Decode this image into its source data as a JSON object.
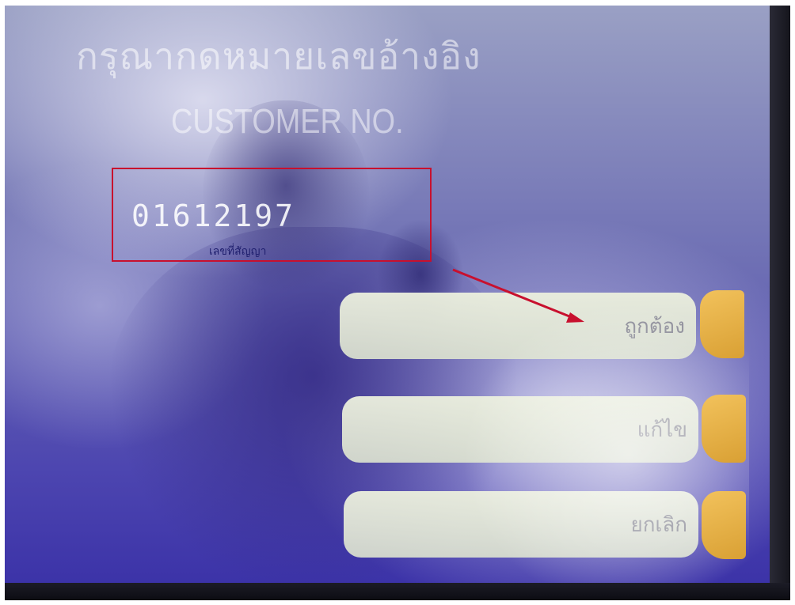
{
  "screen": {
    "title_th": "กรุณากดหมายเลขอ้างอิง",
    "title_en": "CUSTOMER NO.",
    "customer_number": "01612197"
  },
  "annotation": {
    "label": "เลขที่สัญญา",
    "box_color": "#c8102e",
    "arrow_color": "#c8102e"
  },
  "buttons": {
    "confirm": "ถูกต้อง",
    "edit": "แก้ไข",
    "cancel": "ยกเลิก"
  },
  "colors": {
    "screen_blue": "#4d46b0",
    "button_face": "#e2e8d4",
    "side_key": "#e0a83c"
  }
}
